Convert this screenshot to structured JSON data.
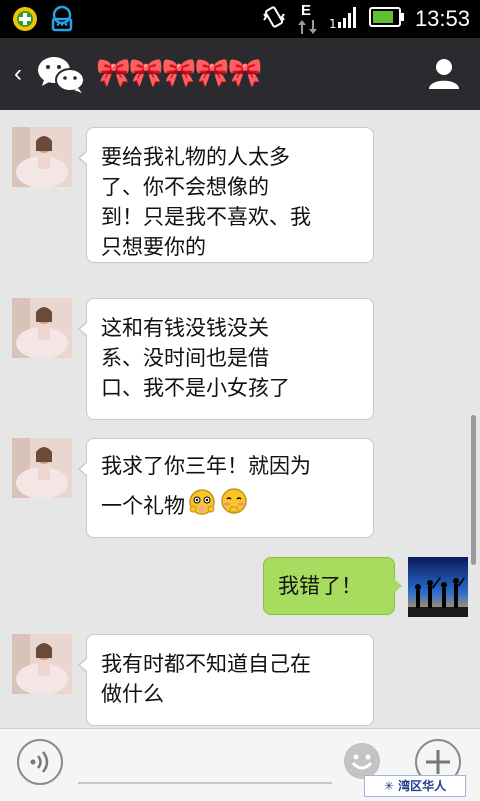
{
  "status_bar": {
    "time": "13:53",
    "network": "E"
  },
  "header": {
    "back_label": "‹",
    "title": "🎀🎀🎀🎀🎀"
  },
  "messages": [
    {
      "side": "in",
      "text": "要给我礼物的人太多了、你不会想像的到！只是我不喜欢、我只想要你的"
    },
    {
      "side": "in",
      "text": "这和有钱没钱没关系、没时间也是借口、我不是小女孩了"
    },
    {
      "side": "in",
      "text": "我求了你三年！就因为一个礼物"
    },
    {
      "side": "out",
      "text": "我错了！"
    },
    {
      "side": "in",
      "text": "我有时都不知道自己在做什么"
    }
  ],
  "lines": {
    "m1": [
      "要给我礼物的人太多",
      "了、你不会想像的",
      "到！只是我不喜欢、我",
      "只想要你的"
    ],
    "m2": [
      "这和有钱没钱没关",
      "系、没时间也是借",
      "口、我不是小女孩了"
    ],
    "m3": [
      "我求了你三年！就因为",
      "一个礼物"
    ],
    "m4": [
      "我错了！"
    ],
    "m5": [
      "我有时都不知道自己在",
      "做什么"
    ]
  },
  "watermark": "✳ 湾区华人",
  "colors": {
    "header_bg": "#2b2b2f",
    "chat_bg": "#e6e6e6",
    "outgoing_bubble": "#a7dc5e",
    "incoming_bubble": "#ffffff"
  }
}
